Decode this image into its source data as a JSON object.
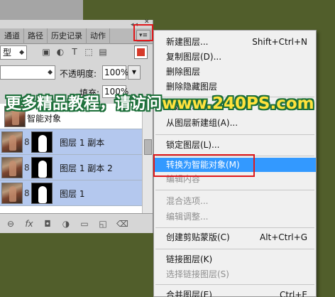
{
  "panel": {
    "tabs": [
      "通道",
      "路径",
      "历史记录",
      "动作"
    ],
    "menu_button_label": "▾≡",
    "close_glyph": "✕",
    "grip": "◂◂",
    "filter_value": "型",
    "blend_mode_value": "",
    "opacity_label": "不透明度:",
    "opacity_value": "100%",
    "fill_label": "填充:",
    "fill_value": "100%",
    "smart_object_label": "智能对象",
    "layers": [
      {
        "name": "图层 1 副本"
      },
      {
        "name": "图层 1 副本 2"
      },
      {
        "name": "图层 1"
      }
    ]
  },
  "context_menu": {
    "items": [
      {
        "label": "新建图层...",
        "shortcut": "Shift+Ctrl+N",
        "disabled": false
      },
      {
        "label": "复制图层(D)...",
        "shortcut": "",
        "disabled": false
      },
      {
        "label": "删除图层",
        "shortcut": "",
        "disabled": false
      },
      {
        "label": "删除隐藏图层",
        "shortcut": "",
        "disabled": false
      },
      {
        "label": "新建组...",
        "shortcut": "",
        "disabled": false
      },
      {
        "label": "从图层新建组(A)...",
        "shortcut": "",
        "disabled": false
      },
      {
        "label": "锁定图层(L)...",
        "shortcut": "",
        "disabled": false
      },
      {
        "label": "转换为智能对象(M)",
        "shortcut": "",
        "disabled": false,
        "highlighted": true
      },
      {
        "label": "编辑内容",
        "shortcut": "",
        "disabled": true
      },
      {
        "label": "混合选项...",
        "shortcut": "",
        "disabled": true
      },
      {
        "label": "编辑调整...",
        "shortcut": "",
        "disabled": true
      },
      {
        "label": "创建剪贴蒙版(C)",
        "shortcut": "Alt+Ctrl+G",
        "disabled": false
      },
      {
        "label": "链接图层(K)",
        "shortcut": "",
        "disabled": false
      },
      {
        "label": "选择链接图层(S)",
        "shortcut": "",
        "disabled": true
      },
      {
        "label": "合并图层(E)",
        "shortcut": "Ctrl+E",
        "disabled": false
      }
    ]
  },
  "watermark": {
    "text": "更多精品教程，请访问",
    "url": "www.240PS.com"
  },
  "colors": {
    "background": "#515e2b",
    "menu_highlight": "#3399ff",
    "annotation_red": "#e0191c",
    "watermark_url": "#ffe23c"
  }
}
